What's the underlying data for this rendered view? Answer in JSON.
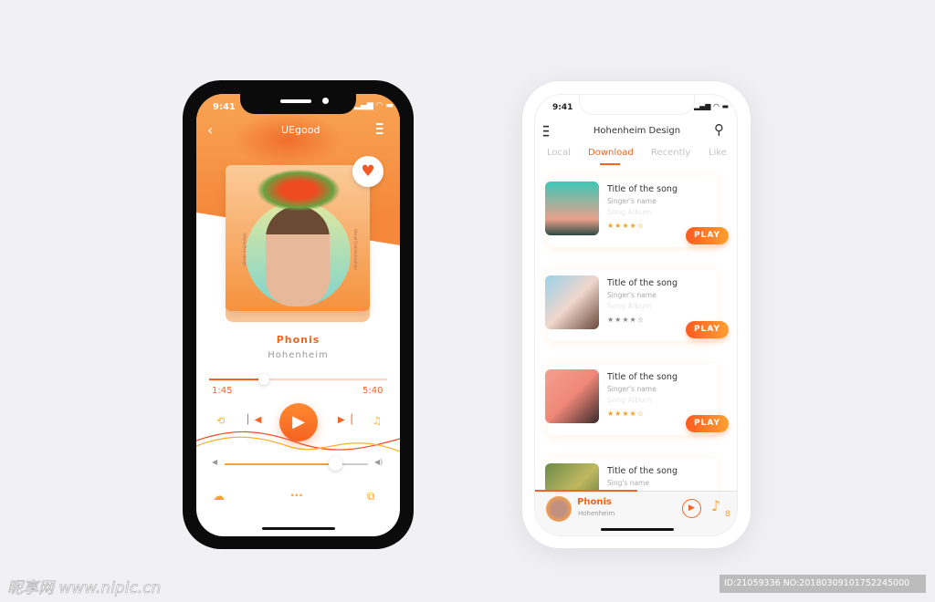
{
  "colors": {
    "accent": "#ff6a1f",
    "accent2": "#ffa82e",
    "background": "#f1f0f5"
  },
  "player": {
    "status_time": "9:41",
    "title": "UEgood",
    "song": "Phonis",
    "artist": "Hohenheim",
    "elapsed": "1:45",
    "duration": "5:40",
    "progress": 0.31,
    "volume": 0.77,
    "album_side_left": "Interactive design",
    "album_side_right": "Visual Communication",
    "icons": [
      "back-icon",
      "menu-icon",
      "heart-icon",
      "repeat-icon",
      "previous-icon",
      "play-icon",
      "next-icon",
      "lyrics-icon",
      "volume-low-icon",
      "volume-high-icon",
      "download-icon",
      "more-icon",
      "share-icon"
    ]
  },
  "library": {
    "status_time": "9:41",
    "title": "Hohenheim Design",
    "tabs": [
      {
        "label": "Local"
      },
      {
        "label": "Download",
        "active": true
      },
      {
        "label": "Recently"
      },
      {
        "label": "Like"
      }
    ],
    "songs": [
      {
        "title": "Title of the song",
        "singer": "Singer's name",
        "album": "Song Album",
        "rating": 4,
        "stars": "★★★★☆",
        "play": "PLAY"
      },
      {
        "title": "Title of the song",
        "singer": "Singer's name",
        "album": "Song Album",
        "rating": 4,
        "stars": "★★★★☆",
        "play": "PLAY"
      },
      {
        "title": "Title of the song",
        "singer": "Singer's name",
        "album": "Song Album",
        "rating": 4,
        "stars": "★★★★☆",
        "play": "PLAY"
      },
      {
        "title": "Title of the song",
        "singer": "Sing's  name"
      }
    ],
    "now_playing": {
      "song": "Phonis",
      "artist": "Hohenheim",
      "queue_count": "8",
      "progress": 0.5
    }
  },
  "watermark": {
    "logo": "昵享网 www.nipic.cn",
    "id": "ID:21059336 NO:20180309101752245000"
  }
}
